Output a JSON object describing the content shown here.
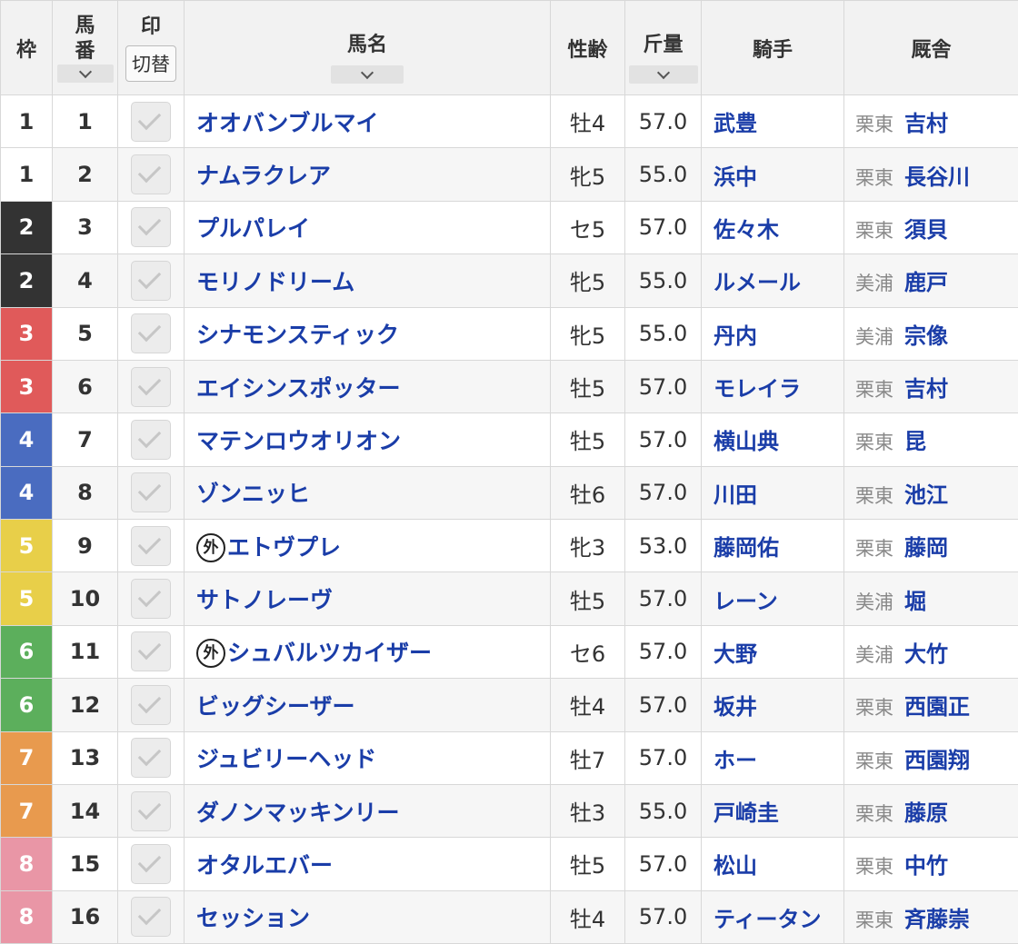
{
  "header": {
    "waku": "枠",
    "umaban_line1": "馬",
    "umaban_line2": "番",
    "mark": "印",
    "mark_toggle": "切替",
    "name": "馬名",
    "sex_age": "性齢",
    "weight": "斤量",
    "jockey": "騎手",
    "stable": "厩舎"
  },
  "colors": {
    "waku_1": "#ffffff",
    "waku_2": "#333333",
    "waku_3": "#e05a5a",
    "waku_4": "#4a6cc0",
    "waku_5": "#e8cf49",
    "waku_6": "#5caf5c",
    "waku_7": "#e89a4e",
    "waku_8": "#e996a6",
    "link_blue": "#1a3da8"
  },
  "icons": {
    "sort": "chevron-down-icon",
    "mark": "check-icon",
    "foreign": "gai-icon"
  },
  "foreign_mark": "外",
  "horses": [
    {
      "waku": "1",
      "num": "1",
      "name": "オオバンブルマイ",
      "foreign": false,
      "sex_age": "牡4",
      "weight": "57.0",
      "jockey": "武豊",
      "region": "栗東",
      "trainer": "吉村"
    },
    {
      "waku": "1",
      "num": "2",
      "name": "ナムラクレア",
      "foreign": false,
      "sex_age": "牝5",
      "weight": "55.0",
      "jockey": "浜中",
      "region": "栗東",
      "trainer": "長谷川"
    },
    {
      "waku": "2",
      "num": "3",
      "name": "プルパレイ",
      "foreign": false,
      "sex_age": "セ5",
      "weight": "57.0",
      "jockey": "佐々木",
      "region": "栗東",
      "trainer": "須貝"
    },
    {
      "waku": "2",
      "num": "4",
      "name": "モリノドリーム",
      "foreign": false,
      "sex_age": "牝5",
      "weight": "55.0",
      "jockey": "ルメール",
      "region": "美浦",
      "trainer": "鹿戸"
    },
    {
      "waku": "3",
      "num": "5",
      "name": "シナモンスティック",
      "foreign": false,
      "sex_age": "牝5",
      "weight": "55.0",
      "jockey": "丹内",
      "region": "美浦",
      "trainer": "宗像"
    },
    {
      "waku": "3",
      "num": "6",
      "name": "エイシンスポッター",
      "foreign": false,
      "sex_age": "牡5",
      "weight": "57.0",
      "jockey": "モレイラ",
      "region": "栗東",
      "trainer": "吉村"
    },
    {
      "waku": "4",
      "num": "7",
      "name": "マテンロウオリオン",
      "foreign": false,
      "sex_age": "牡5",
      "weight": "57.0",
      "jockey": "横山典",
      "region": "栗東",
      "trainer": "昆"
    },
    {
      "waku": "4",
      "num": "8",
      "name": "ゾンニッヒ",
      "foreign": false,
      "sex_age": "牡6",
      "weight": "57.0",
      "jockey": "川田",
      "region": "栗東",
      "trainer": "池江"
    },
    {
      "waku": "5",
      "num": "9",
      "name": "エトヴプレ",
      "foreign": true,
      "sex_age": "牝3",
      "weight": "53.0",
      "jockey": "藤岡佑",
      "region": "栗東",
      "trainer": "藤岡"
    },
    {
      "waku": "5",
      "num": "10",
      "name": "サトノレーヴ",
      "foreign": false,
      "sex_age": "牡5",
      "weight": "57.0",
      "jockey": "レーン",
      "region": "美浦",
      "trainer": "堀"
    },
    {
      "waku": "6",
      "num": "11",
      "name": "シュバルツカイザー",
      "foreign": true,
      "sex_age": "セ6",
      "weight": "57.0",
      "jockey": "大野",
      "region": "美浦",
      "trainer": "大竹"
    },
    {
      "waku": "6",
      "num": "12",
      "name": "ビッグシーザー",
      "foreign": false,
      "sex_age": "牡4",
      "weight": "57.0",
      "jockey": "坂井",
      "region": "栗東",
      "trainer": "西園正"
    },
    {
      "waku": "7",
      "num": "13",
      "name": "ジュビリーヘッド",
      "foreign": false,
      "sex_age": "牡7",
      "weight": "57.0",
      "jockey": "ホー",
      "region": "栗東",
      "trainer": "西園翔"
    },
    {
      "waku": "7",
      "num": "14",
      "name": "ダノンマッキンリー",
      "foreign": false,
      "sex_age": "牡3",
      "weight": "55.0",
      "jockey": "戸崎圭",
      "region": "栗東",
      "trainer": "藤原"
    },
    {
      "waku": "8",
      "num": "15",
      "name": "オタルエバー",
      "foreign": false,
      "sex_age": "牡5",
      "weight": "57.0",
      "jockey": "松山",
      "region": "栗東",
      "trainer": "中竹"
    },
    {
      "waku": "8",
      "num": "16",
      "name": "セッション",
      "foreign": false,
      "sex_age": "牡4",
      "weight": "57.0",
      "jockey": "ティータン",
      "region": "栗東",
      "trainer": "斉藤崇"
    }
  ]
}
